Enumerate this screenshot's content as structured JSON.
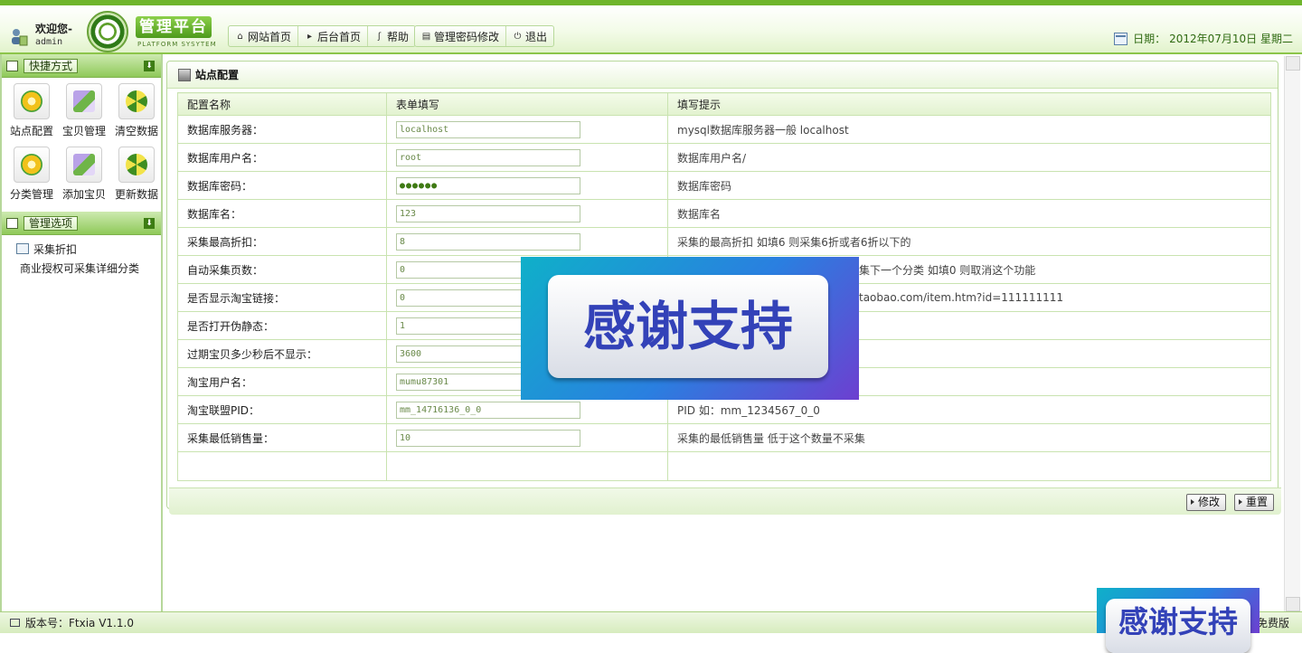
{
  "header": {
    "welcome": "欢迎您-",
    "username": "admin",
    "logo_title": "管理平台",
    "logo_subtitle": "PLATFORM SYSYTEM",
    "nav_group_1": [
      {
        "label": "网站首页",
        "icon": "home-icon"
      },
      {
        "label": "后台首页",
        "icon": "play-icon"
      },
      {
        "label": "帮助",
        "icon": "help-icon"
      }
    ],
    "nav_group_2": [
      {
        "label": "管理密码修改",
        "icon": "list-icon"
      },
      {
        "label": "退出",
        "icon": "power-icon"
      }
    ],
    "date_label": "日期：",
    "date_value": "2012年07月10日 星期二"
  },
  "sidebar": {
    "shortcuts_title": "快捷方式",
    "shortcuts": [
      {
        "label": "站点配置",
        "icon": "gear-icon"
      },
      {
        "label": "宝贝管理",
        "icon": "pencil-icon"
      },
      {
        "label": "清空数据",
        "icon": "radiation-icon"
      },
      {
        "label": "分类管理",
        "icon": "gear-icon"
      },
      {
        "label": "添加宝贝",
        "icon": "pencil-icon"
      },
      {
        "label": "更新数据",
        "icon": "radiation-icon"
      }
    ],
    "manage_title": "管理选项",
    "manage_items": [
      {
        "label": "采集折扣"
      }
    ],
    "manage_note": "商业授权可采集详细分类"
  },
  "main": {
    "title": "站点配置",
    "columns": [
      "配置名称",
      "表单填写",
      "填写提示"
    ],
    "rows": [
      {
        "label": "数据库服务器：",
        "value": "localhost",
        "hint": "mysql数据库服务器一般 localhost"
      },
      {
        "label": "数据库用户名：",
        "value": "root",
        "hint": "数据库用户名/"
      },
      {
        "label": "数据库密码：",
        "value": "●●●●●●",
        "hint": "数据库密码"
      },
      {
        "label": "数据库名：",
        "value": "123",
        "hint": "数据库名"
      },
      {
        "label": "采集最高折扣：",
        "value": "8",
        "hint": "采集的最高折扣 如填6 则采集6折或者6折以下的"
      },
      {
        "label": "自动采集页数：",
        "value": "0",
        "hint": "集下一个分类 如填0 则取消这个功能"
      },
      {
        "label": "是否显示淘宝链接：",
        "value": "0",
        "hint": "taobao.com/item.htm?id=111111111"
      },
      {
        "label": "是否打开伪静态：",
        "value": "1",
        "hint": ""
      },
      {
        "label": "过期宝贝多少秒后不显示：",
        "value": "3600",
        "hint": ""
      },
      {
        "label": "淘宝用户名：",
        "value": "mumu87301",
        "hint": ""
      },
      {
        "label": "淘宝联盟PID：",
        "value": "mm_14716136_0_0",
        "hint": "PID 如：mm_1234567_0_0"
      },
      {
        "label": "采集最低销售量：",
        "value": "10",
        "hint": "采集的最低销售量 低于这个数量不采集"
      }
    ],
    "buttons": {
      "modify": "修改",
      "reset": "重置"
    }
  },
  "overlay": {
    "thanks_text": "感谢支持",
    "thanks_text_corner": "感谢支持"
  },
  "footer": {
    "version": "版本号：Ftxia V1.1.0",
    "edition": "免费版"
  },
  "colors": {
    "accent_green": "#6fb52c",
    "header_green_light": "#e2f3cc",
    "panel_head_green": "#8fc959",
    "overlay_blue": "#2a7fe0",
    "overlay_text": "#3342b8"
  }
}
